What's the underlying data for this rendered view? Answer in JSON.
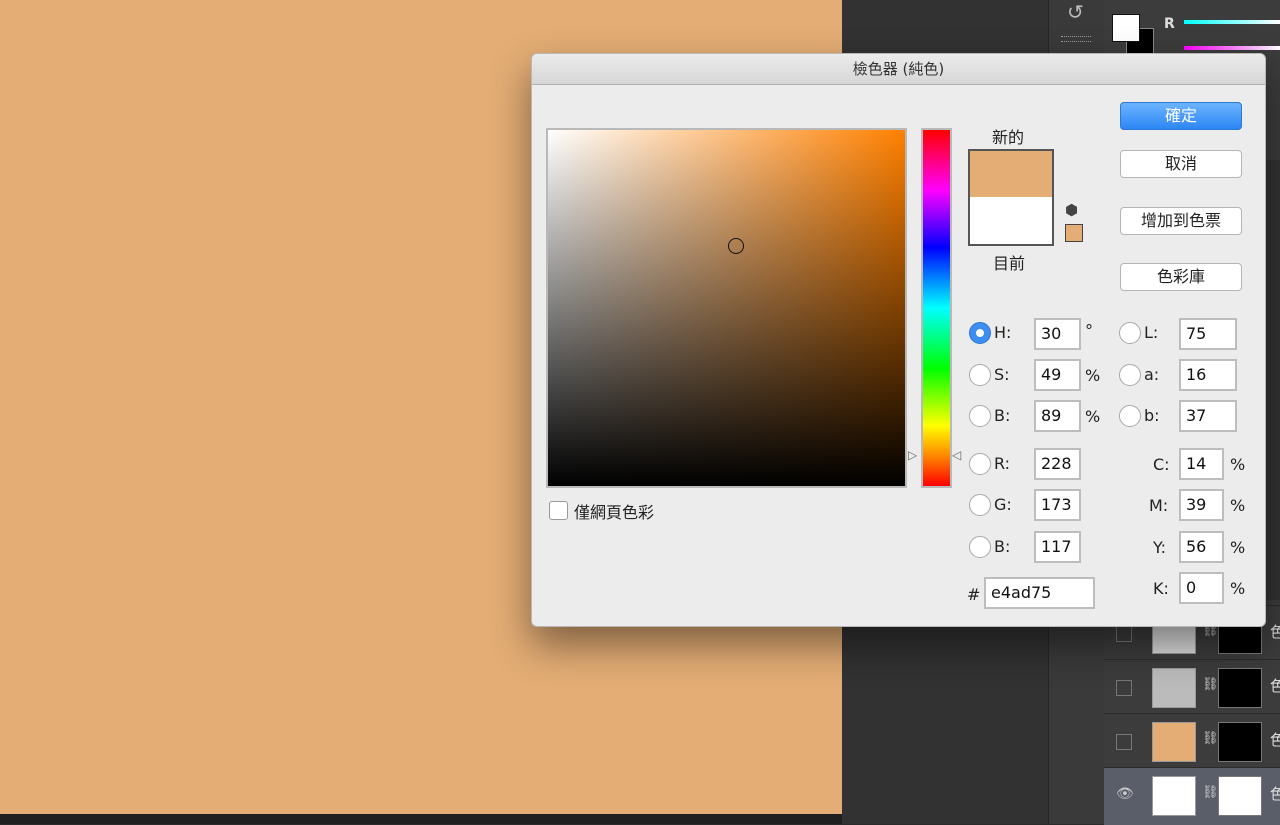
{
  "colors": {
    "new": "#e4ad75",
    "current": "#ffffff",
    "canvas": "#e4ad75"
  },
  "panel": {
    "r_label": "R"
  },
  "dialog": {
    "title": "檢色器 (純色)",
    "new_label": "新的",
    "current_label": "目前",
    "web_only_label": "僅網頁色彩",
    "buttons": {
      "ok": "確定",
      "cancel": "取消",
      "add_swatch": "增加到色票",
      "libraries": "色彩庫"
    },
    "hsb": {
      "h": {
        "label": "H:",
        "value": "30",
        "unit": "°"
      },
      "s": {
        "label": "S:",
        "value": "49",
        "unit": "%"
      },
      "b": {
        "label": "B:",
        "value": "89",
        "unit": "%"
      }
    },
    "rgb": {
      "r": {
        "label": "R:",
        "value": "228"
      },
      "g": {
        "label": "G:",
        "value": "173"
      },
      "b": {
        "label": "B:",
        "value": "117"
      }
    },
    "lab": {
      "l": {
        "label": "L:",
        "value": "75"
      },
      "a": {
        "label": "a:",
        "value": "16"
      },
      "b": {
        "label": "b:",
        "value": "37"
      }
    },
    "cmyk": {
      "c": {
        "label": "C:",
        "value": "14",
        "unit": "%"
      },
      "m": {
        "label": "M:",
        "value": "39",
        "unit": "%"
      },
      "y": {
        "label": "Y:",
        "value": "56",
        "unit": "%"
      },
      "k": {
        "label": "K:",
        "value": "0",
        "unit": "%"
      }
    },
    "hex": {
      "label": "#",
      "value": "e4ad75"
    }
  },
  "layers": {
    "name_glyph": "色",
    "eye_icon": "eye-icon",
    "link_icon": "chain-icon"
  }
}
